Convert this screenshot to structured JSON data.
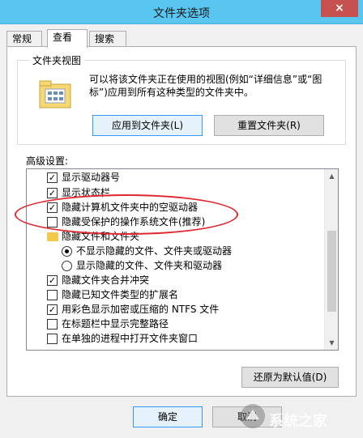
{
  "window": {
    "title": "文件夹选项",
    "close_label": "×"
  },
  "tabs": [
    {
      "label": "常规"
    },
    {
      "label": "查看"
    },
    {
      "label": "搜索"
    }
  ],
  "folder_views": {
    "group_label": "文件夹视图",
    "description": "可以将该文件夹正在使用的视图(例如“详细信息”或“图标”)应用到所有这种类型的文件夹中。",
    "apply_button": "应用到文件夹(L)",
    "reset_button": "重置文件夹(R)"
  },
  "advanced": {
    "label": "高级设置:",
    "items": [
      {
        "type": "checkbox",
        "checked": true,
        "label": "显示驱动器号"
      },
      {
        "type": "checkbox",
        "checked": true,
        "label": "显示状态栏"
      },
      {
        "type": "checkbox",
        "checked": true,
        "label": "隐藏计算机文件夹中的空驱动器"
      },
      {
        "type": "checkbox",
        "checked": false,
        "label": "隐藏受保护的操作系统文件(推荐)"
      },
      {
        "type": "folder",
        "label": "隐藏文件和文件夹"
      },
      {
        "type": "radio",
        "checked": true,
        "label": "不显示隐藏的文件、文件夹或驱动器"
      },
      {
        "type": "radio",
        "checked": false,
        "label": "显示隐藏的文件、文件夹和驱动器"
      },
      {
        "type": "checkbox",
        "checked": true,
        "label": "隐藏文件夹合并冲突"
      },
      {
        "type": "checkbox",
        "checked": false,
        "label": "隐藏已知文件类型的扩展名"
      },
      {
        "type": "checkbox",
        "checked": true,
        "label": "用彩色显示加密或压缩的 NTFS 文件"
      },
      {
        "type": "checkbox",
        "checked": false,
        "label": "在标题栏中显示完整路径"
      },
      {
        "type": "checkbox",
        "checked": false,
        "label": "在单独的进程中打开文件夹窗口"
      }
    ],
    "restore_button": "还原为默认值(D)"
  },
  "footer": {
    "ok_button": "确定",
    "cancel_button": "取消"
  },
  "watermark": {
    "text": "系统之家"
  },
  "colors": {
    "titlebar": "#59c6f2",
    "annotation": "#e0282f"
  }
}
